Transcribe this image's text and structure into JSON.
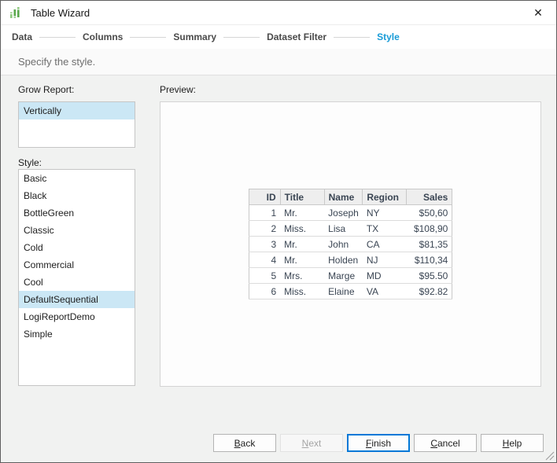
{
  "window": {
    "title": "Table Wizard",
    "close_glyph": "✕"
  },
  "wizard_steps": {
    "items": [
      {
        "label": "Data",
        "active": false
      },
      {
        "label": "Columns",
        "active": false
      },
      {
        "label": "Summary",
        "active": false
      },
      {
        "label": "Dataset Filter",
        "active": false
      },
      {
        "label": "Style",
        "active": true
      }
    ]
  },
  "subtitle": "Specify the style.",
  "grow_report": {
    "label": "Grow Report:",
    "options": [
      "Vertically"
    ],
    "selected": "Vertically"
  },
  "style": {
    "label": "Style:",
    "options": [
      "Basic",
      "Black",
      "BottleGreen",
      "Classic",
      "Cold",
      "Commercial",
      "Cool",
      "DefaultSequential",
      "LogiReportDemo",
      "Simple"
    ],
    "selected": "DefaultSequential"
  },
  "preview": {
    "label": "Preview:",
    "table": {
      "columns": [
        "ID",
        "Title",
        "Name",
        "Region",
        "Sales"
      ],
      "right_aligned_columns": [
        "ID",
        "Sales"
      ],
      "rows": [
        [
          "1",
          "Mr.",
          "Joseph",
          "NY",
          "$50,60"
        ],
        [
          "2",
          "Miss.",
          "Lisa",
          "TX",
          "$108,90"
        ],
        [
          "3",
          "Mr.",
          "John",
          "CA",
          "$81,35"
        ],
        [
          "4",
          "Mr.",
          "Holden",
          "NJ",
          "$110,34"
        ],
        [
          "5",
          "Mrs.",
          "Marge",
          "MD",
          "$95.50"
        ],
        [
          "6",
          "Miss.",
          "Elaine",
          "VA",
          "$92.82"
        ]
      ]
    }
  },
  "buttons": [
    {
      "label": "Back",
      "mnemonic": "B",
      "enabled": true,
      "default": false
    },
    {
      "label": "Next",
      "mnemonic": "N",
      "enabled": false,
      "default": false
    },
    {
      "label": "Finish",
      "mnemonic": "F",
      "enabled": true,
      "default": true
    },
    {
      "label": "Cancel",
      "mnemonic": "C",
      "enabled": true,
      "default": false
    },
    {
      "label": "Help",
      "mnemonic": "H",
      "enabled": true,
      "default": false
    }
  ],
  "colors": {
    "accent_blue": "#189bd7",
    "selection_bg": "#cbe7f5",
    "default_button_border": "#0078d7",
    "icon_green_light": "#8dc87e",
    "icon_green_dark": "#5aa84c",
    "table_text": "#3a4553"
  }
}
